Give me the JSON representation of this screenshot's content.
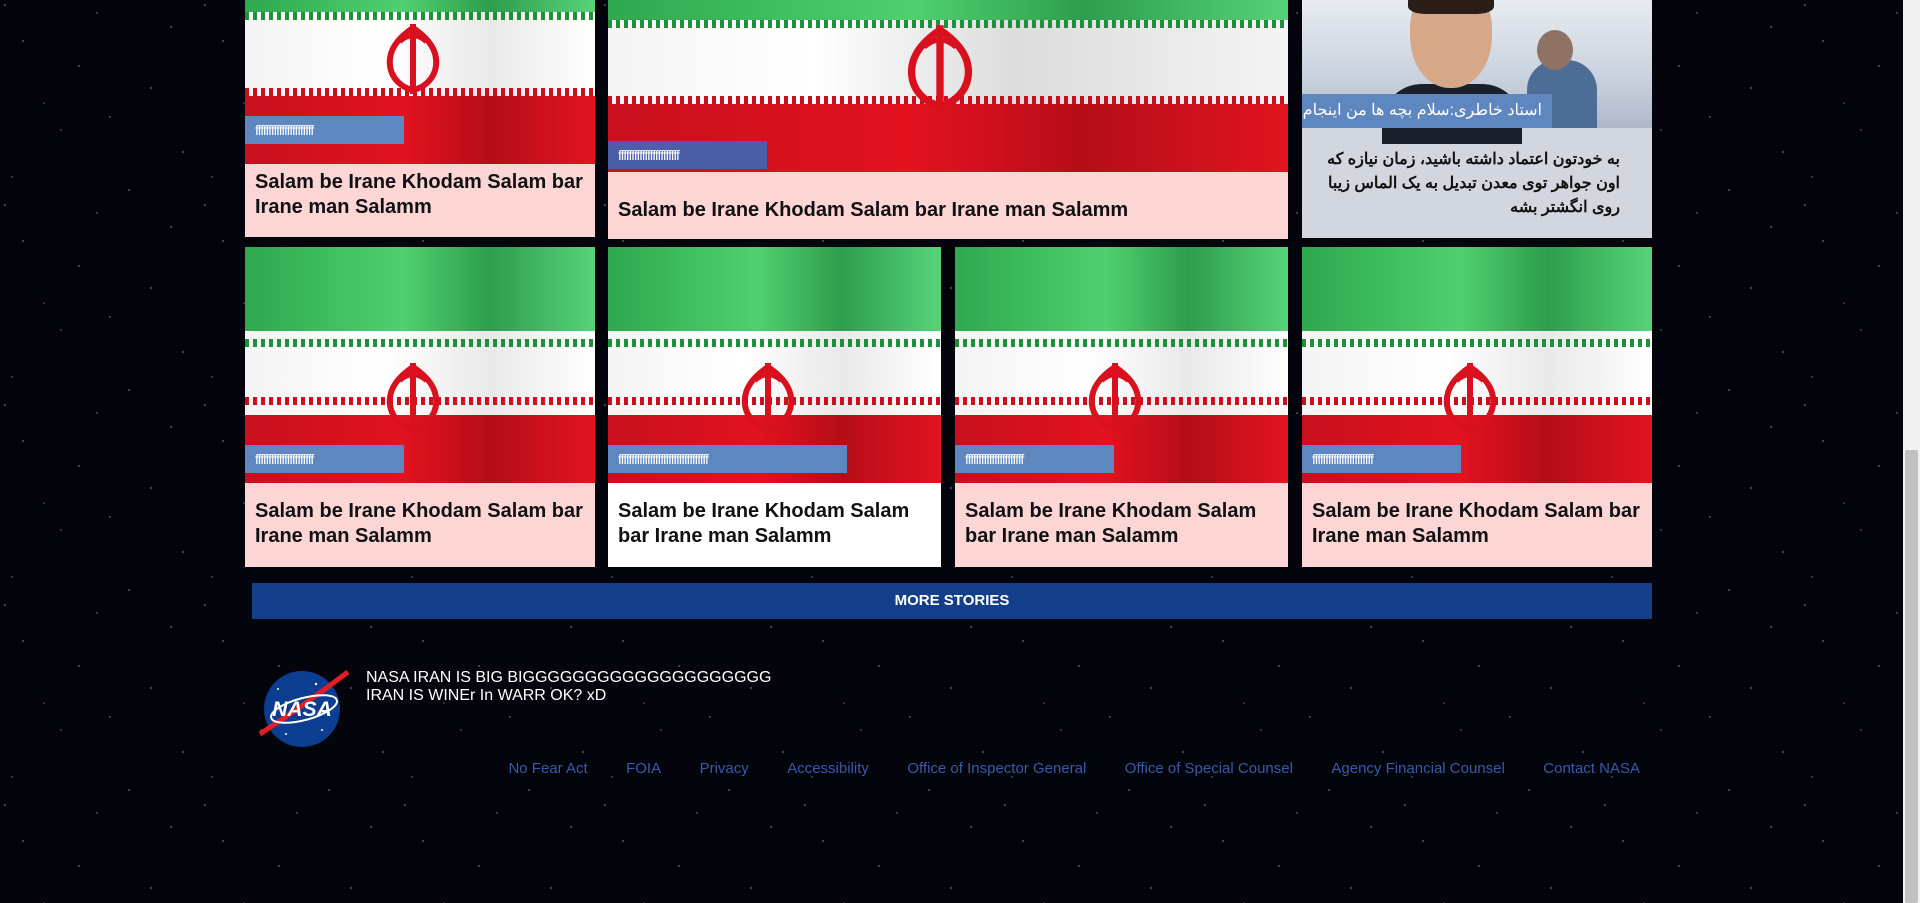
{
  "stories": [
    {
      "tag": "ffffffffffffffffffffff",
      "title": "Salam be Irane Khodam Salam bar Irane man Salamm"
    },
    {
      "tag": "fffffffffffffffffffffff",
      "title": "Salam be Irane Khodam Salam bar Irane man Salamm"
    },
    {
      "tag": "استاد خاطری:سلام بچه ها من اینجام",
      "title": "به خودتون اعتماد داشته باشید، زمان نیازه که اون جواهر توی معدن تبدیل به یک الماس زیبا روی انگشتر بشه"
    },
    {
      "tag": "ffffffffffffffffffffff",
      "title": "Salam be Irane Khodam Salam bar Irane man Salamm"
    },
    {
      "tag": "ffffffffffffffffffffffffffffffffff",
      "title": "Salam be Irane Khodam Salam bar Irane man Salamm"
    },
    {
      "tag": "ffffffffffffffffffffff",
      "title": "Salam be Irane Khodam Salam bar Irane man Salamm"
    },
    {
      "tag": "fffffffffffffffffffffff",
      "title": "Salam be Irane Khodam Salam bar Irane man Salamm"
    }
  ],
  "more_stories_label": "MORE STORIES",
  "footer": {
    "logo_text": "NASA",
    "message_line1": "NASA IRAN IS BIG BIGGGGGGGGGGGGGGGGGGGG",
    "message_line2": "IRAN IS WINEr In WARR OK? xD",
    "links": [
      "No Fear Act",
      "FOIA",
      "Privacy",
      "Accessibility",
      "Office of Inspector General",
      "Office of Special Counsel",
      "Agency Financial Counsel",
      "Contact NASA"
    ]
  },
  "colors": {
    "flag_green": "#2fa84f",
    "flag_red": "#e3121f",
    "tag_bg": "#5f87bf",
    "card_bg": "#fcd5d5",
    "more_bg": "#133e89",
    "link": "#3a5aa8"
  }
}
